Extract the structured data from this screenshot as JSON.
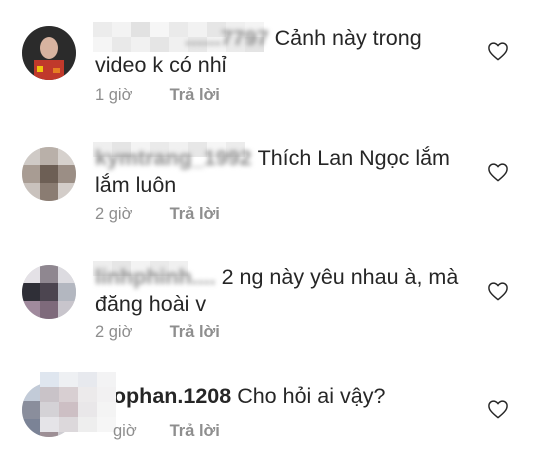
{
  "comments": [
    {
      "username": "......7797",
      "text": "Cảnh này trong video k có nhỉ",
      "time": "1 giờ",
      "reply_label": "Trả lời"
    },
    {
      "username": "kymtrang_1992",
      "text": "Thích Lan Ngọc lắm lắm luôn",
      "time": "2 giờ",
      "reply_label": "Trả lời"
    },
    {
      "username": "linhphinh....",
      "text": "2 ng này yêu nhau à, mà đăng hoài v",
      "time": "2 giờ",
      "reply_label": "Trả lời"
    },
    {
      "username": "...ophan.1208",
      "text": "Cho hỏi ai vậy?",
      "time": "giờ",
      "reply_label": "Trả lời"
    }
  ],
  "icons": {
    "like": "heart-outline-icon"
  },
  "colors": {
    "text": "#262626",
    "secondary": "#8e8e8e",
    "background": "#ffffff"
  }
}
